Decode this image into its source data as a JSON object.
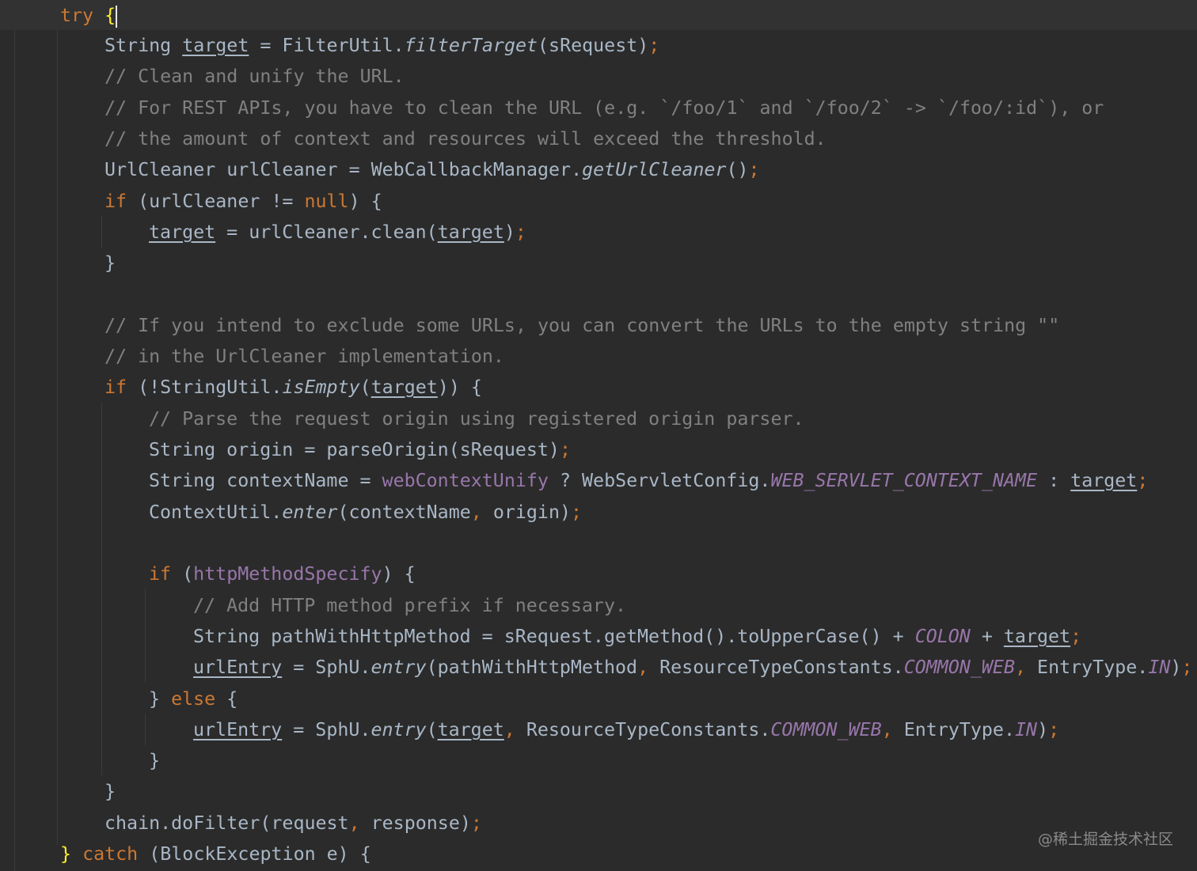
{
  "watermark": "@稀土掘金技术社区",
  "code": {
    "l01": {
      "kw_try": "try",
      "brace": "{"
    },
    "l02": {
      "t1": "String ",
      "var": "target",
      "t2": " = FilterUtil.",
      "method": "filterTarget",
      "t3": "(sRequest)",
      "semi": ";"
    },
    "l03": {
      "comment": "// Clean and unify the URL."
    },
    "l04": {
      "comment": "// For REST APIs, you have to clean the URL (e.g. `/foo/1` and `/foo/2` -> `/foo/:id`), or"
    },
    "l05": {
      "comment": "// the amount of context and resources will exceed the threshold."
    },
    "l06": {
      "t1": "UrlCleaner urlCleaner = WebCallbackManager.",
      "method": "getUrlCleaner",
      "t2": "()",
      "semi": ";"
    },
    "l07": {
      "kw_if": "if",
      "t1": " (urlCleaner != ",
      "kw_null": "null",
      "t2": ") {"
    },
    "l08": {
      "var1": "target",
      "t1": " = urlCleaner.clean(",
      "var2": "target",
      "t2": ")",
      "semi": ";"
    },
    "l09": {
      "brace": "}"
    },
    "l11": {
      "comment": "// If you intend to exclude some URLs, you can convert the URLs to the empty string \"\""
    },
    "l12": {
      "comment": "// in the UrlCleaner implementation."
    },
    "l13": {
      "kw_if": "if",
      "t1": " (!StringUtil.",
      "method": "isEmpty",
      "t2": "(",
      "var": "target",
      "t3": ")) {"
    },
    "l14": {
      "comment": "// Parse the request origin using registered origin parser."
    },
    "l15": {
      "t1": "String origin = parseOrigin(sRequest)",
      "semi": ";"
    },
    "l16": {
      "t1": "String contextName = ",
      "field": "webContextUnify",
      "t2": " ? WebServletConfig.",
      "const": "WEB_SERVLET_CONTEXT_NAME",
      "t3": " : ",
      "var": "target",
      "semi": ";"
    },
    "l17": {
      "t1": "ContextUtil.",
      "method": "enter",
      "t2": "(contextName",
      "comma": ",",
      "t3": " origin)",
      "semi": ";"
    },
    "l19": {
      "kw_if": "if",
      "t1": " (",
      "field": "httpMethodSpecify",
      "t2": ") {"
    },
    "l20": {
      "comment": "// Add HTTP method prefix if necessary."
    },
    "l21": {
      "t1": "String pathWithHttpMethod = sRequest.getMethod().toUpperCase() + ",
      "const": "COLON",
      "t2": " + ",
      "var": "target",
      "semi": ";"
    },
    "l22": {
      "var": "urlEntry",
      "t1": " = SphU.",
      "method": "entry",
      "t2": "(pathWithHttpMethod",
      "comma1": ",",
      "t3": " ResourceTypeConstants.",
      "const1": "COMMON_WEB",
      "comma2": ",",
      "t4": " EntryType.",
      "const2": "IN",
      "t5": ")",
      "semi": ";"
    },
    "l23": {
      "t1": "} ",
      "kw_else": "else",
      "t2": " {"
    },
    "l24": {
      "var1": "urlEntry",
      "t1": " = SphU.",
      "method": "entry",
      "t2": "(",
      "var2": "target",
      "comma1": ",",
      "t3": " ResourceTypeConstants.",
      "const1": "COMMON_WEB",
      "comma2": ",",
      "t4": " EntryType.",
      "const2": "IN",
      "t5": ")",
      "semi": ";"
    },
    "l25": {
      "brace": "}"
    },
    "l26": {
      "brace": "}"
    },
    "l27": {
      "t1": "chain.doFilter(request",
      "comma": ",",
      "t2": " response)",
      "semi": ";"
    },
    "l28": {
      "brace": "}",
      "kw_catch": "catch",
      "t1": " (BlockException e) {"
    }
  }
}
